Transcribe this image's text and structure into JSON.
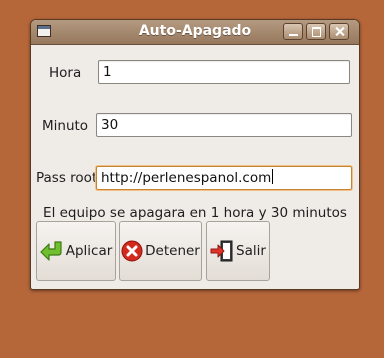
{
  "window": {
    "title": "Auto-Apagado"
  },
  "form": {
    "hora_label": "Hora",
    "hora_value": "1",
    "minuto_label": "Minuto",
    "minuto_value": "30",
    "pass_label": "Pass root",
    "pass_value": "http://perlenespanol.com"
  },
  "status": {
    "message": "El equipo se apagara en 1 hora y 30 minutos"
  },
  "buttons": {
    "aplicar": "Aplicar",
    "detener": "Detener",
    "salir": "Salir"
  },
  "icons": {
    "aplicar": "green-arrow-icon",
    "detener": "red-stop-icon",
    "salir": "exit-door-icon"
  },
  "colors": {
    "desktop": "#b5673a",
    "titlebar": "#a4886d",
    "window_bg": "#efebe7",
    "focus": "#c78335"
  }
}
